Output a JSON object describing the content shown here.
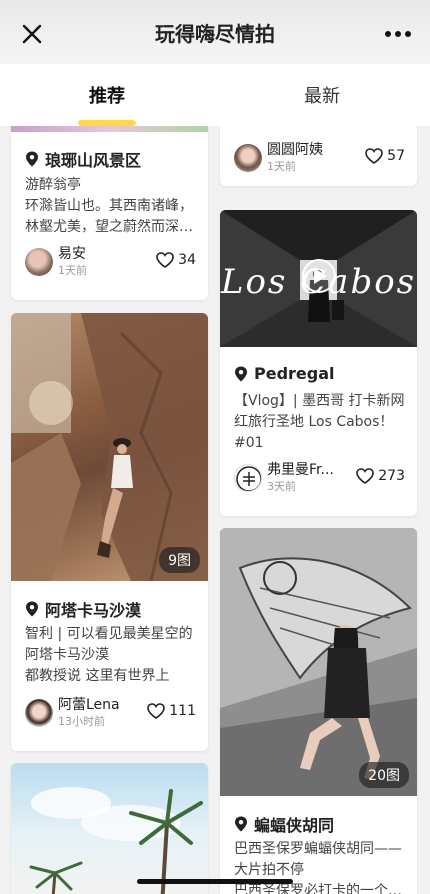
{
  "header": {
    "title": "玩得嗨尽情拍"
  },
  "tabs": [
    {
      "label": "推荐",
      "active": true
    },
    {
      "label": "最新",
      "active": false
    }
  ],
  "feed": {
    "left": [
      {
        "location": "琅琊山风景区",
        "desc": "游醉翁亭\n环滁皆山也。其西南诸峰，林壑尤美，望之蔚然而深…",
        "author": "易安",
        "time": "1天前",
        "likes": "34"
      },
      {
        "badge": "9图",
        "location": "阿塔卡马沙漠",
        "desc": "智利 | 可以看见最美星空的阿塔卡马沙漠\n都教授说 这里有世界上最…",
        "author": "阿蕾Lena",
        "time": "13小时前",
        "likes": "111"
      }
    ],
    "right": [
      {
        "author": "圆圆阿姨",
        "time": "1天前",
        "likes": "57"
      },
      {
        "overlay_text": "Los Cabos",
        "location": "Pedregal",
        "desc": "【Vlog】| 墨西哥 打卡新网红旅行圣地 Los Cabos！#01",
        "author": "弗里曼Fr...",
        "time": "3天前",
        "likes": "273"
      },
      {
        "badge": "20图",
        "location": "蝙蝠侠胡同",
        "desc": "巴西圣保罗蝙蝠侠胡同——大片拍不停\n巴西圣保罗必打卡的一个…"
      }
    ]
  },
  "colors": {
    "accent": "#ffd94a"
  }
}
